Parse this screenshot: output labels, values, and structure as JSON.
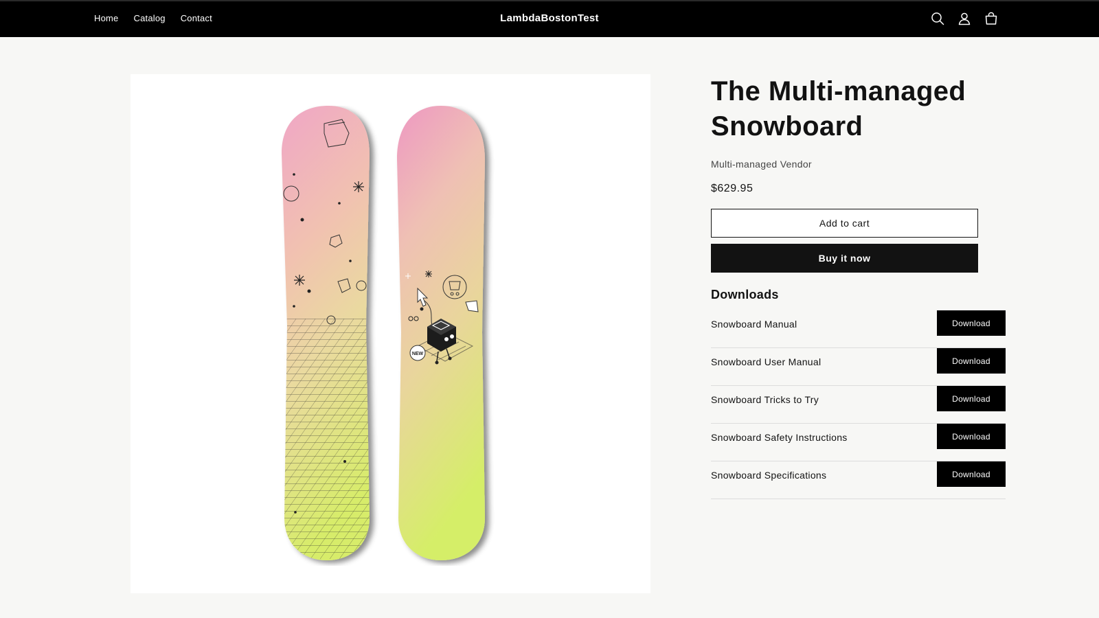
{
  "header": {
    "nav": [
      {
        "label": "Home"
      },
      {
        "label": "Catalog"
      },
      {
        "label": "Contact"
      }
    ],
    "brand": "LambdaBostonTest",
    "icons": [
      "search-icon",
      "account-icon",
      "cart-icon"
    ]
  },
  "product": {
    "title": "The Multi-managed Snowboard",
    "vendor": "Multi-managed Vendor",
    "price": "$629.95",
    "add_to_cart_label": "Add to cart",
    "buy_now_label": "Buy it now",
    "image_board_badge": "NEW"
  },
  "downloads": {
    "heading": "Downloads",
    "items": [
      {
        "name": "Snowboard Manual",
        "button": "Download"
      },
      {
        "name": "Snowboard User Manual",
        "button": "Download"
      },
      {
        "name": "Snowboard Tricks to Try",
        "button": "Download"
      },
      {
        "name": "Snowboard Safety Instructions",
        "button": "Download"
      },
      {
        "name": "Snowboard Specifications",
        "button": "Download"
      }
    ]
  },
  "colors": {
    "header_bg": "#000000",
    "page_bg": "#f7f7f5",
    "board_pink": "#f0a6c6",
    "board_peach": "#f1d2a6",
    "board_lime": "#d8ee6e"
  }
}
